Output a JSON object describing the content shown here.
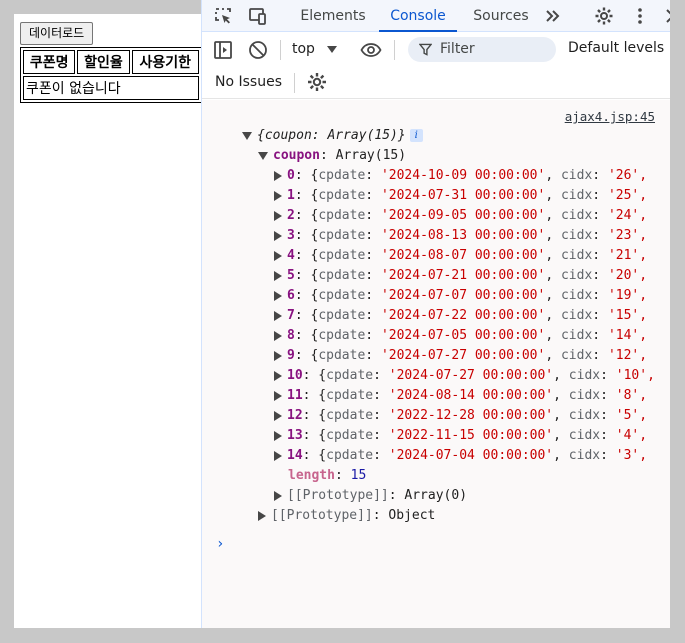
{
  "page": {
    "load_button": "데이터로드",
    "table_headers": [
      "쿠폰명",
      "할인율",
      "사용기한"
    ],
    "empty_message": "쿠폰이 없습니다"
  },
  "devtools": {
    "tabs": [
      {
        "label": "Elements",
        "active": false
      },
      {
        "label": "Console",
        "active": true
      },
      {
        "label": "Sources",
        "active": false
      }
    ],
    "more_tabs_icon": "double-chevron-right-icon",
    "context_select": "top",
    "filter_placeholder": "Filter",
    "levels_label": "Default levels",
    "issues_label": "No Issues",
    "accent_color": "#0b57d0"
  },
  "console": {
    "source_link": "ajax4.jsp:45",
    "object_summary": "{coupon: Array(15)}",
    "coupon_key": "coupon",
    "coupon_type": "Array(15)",
    "items": [
      {
        "index": "0",
        "cpdate": "'2024-10-09 00:00:00'",
        "cidx": "'26',"
      },
      {
        "index": "1",
        "cpdate": "'2024-07-31 00:00:00'",
        "cidx": "'25',"
      },
      {
        "index": "2",
        "cpdate": "'2024-09-05 00:00:00'",
        "cidx": "'24',"
      },
      {
        "index": "3",
        "cpdate": "'2024-08-13 00:00:00'",
        "cidx": "'23',"
      },
      {
        "index": "4",
        "cpdate": "'2024-08-07 00:00:00'",
        "cidx": "'21',"
      },
      {
        "index": "5",
        "cpdate": "'2024-07-21 00:00:00'",
        "cidx": "'20',"
      },
      {
        "index": "6",
        "cpdate": "'2024-07-07 00:00:00'",
        "cidx": "'19',"
      },
      {
        "index": "7",
        "cpdate": "'2024-07-22 00:00:00'",
        "cidx": "'15',"
      },
      {
        "index": "8",
        "cpdate": "'2024-07-05 00:00:00'",
        "cidx": "'14',"
      },
      {
        "index": "9",
        "cpdate": "'2024-07-27 00:00:00'",
        "cidx": "'12',"
      },
      {
        "index": "10",
        "cpdate": "'2024-07-27 00:00:00'",
        "cidx": "'10',"
      },
      {
        "index": "11",
        "cpdate": "'2024-08-14 00:00:00'",
        "cidx": "'8',"
      },
      {
        "index": "12",
        "cpdate": "'2022-12-28 00:00:00'",
        "cidx": "'5',"
      },
      {
        "index": "13",
        "cpdate": "'2022-11-15 00:00:00'",
        "cidx": "'4',"
      },
      {
        "index": "14",
        "cpdate": "'2024-07-04 00:00:00'",
        "cidx": "'3',"
      }
    ],
    "length_key": "length",
    "length_value": "15",
    "array_prototype_key": "[[Prototype]]",
    "array_prototype_value": "Array(0)",
    "object_prototype_key": "[[Prototype]]",
    "object_prototype_value": "Object",
    "prompt_symbol": "›"
  }
}
